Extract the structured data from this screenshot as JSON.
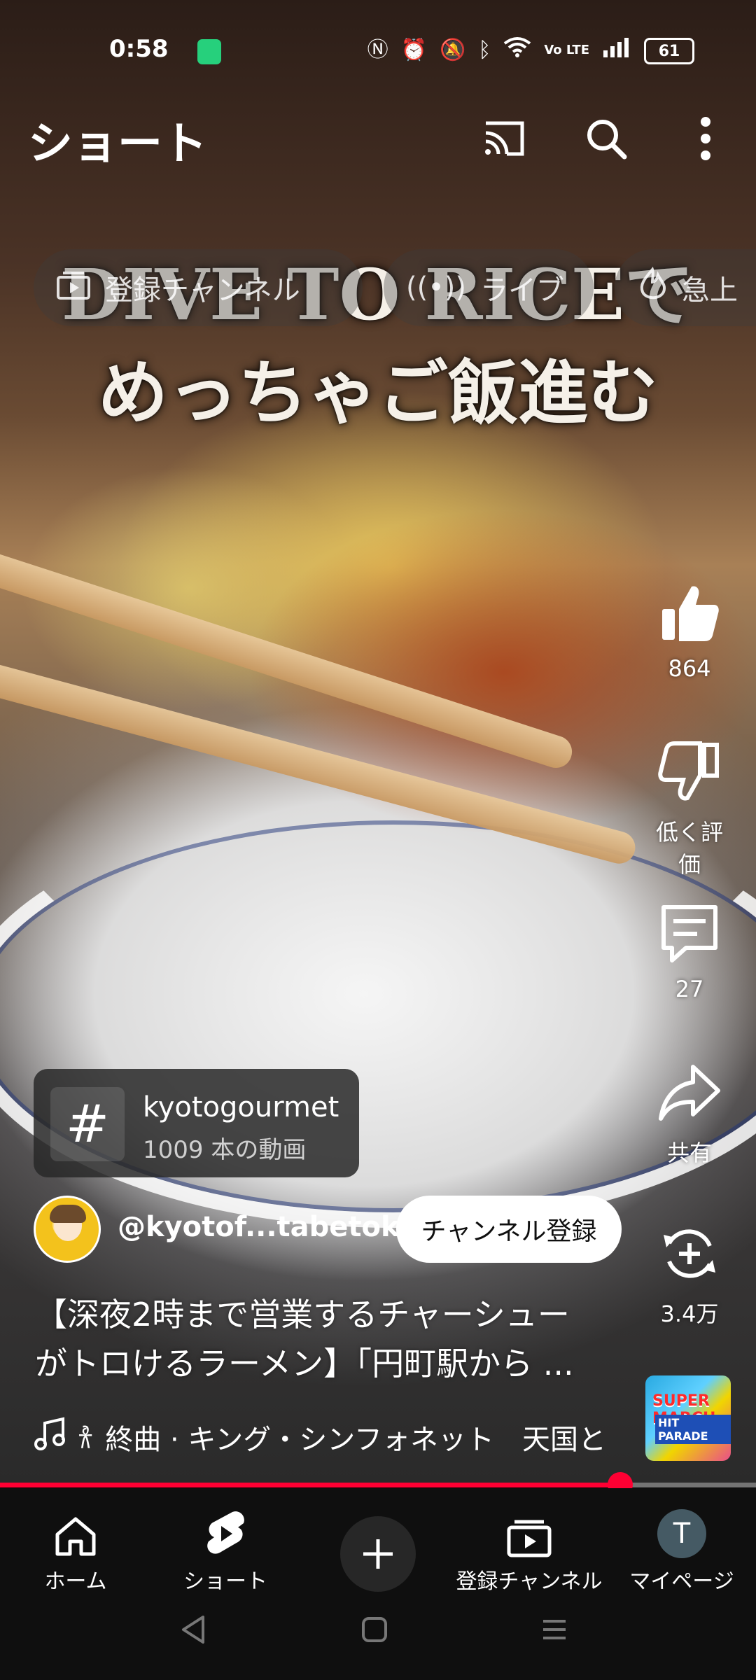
{
  "status_bar": {
    "time": "0:58",
    "battery": "61",
    "icons": [
      "nfc-icon",
      "alarm-icon",
      "mute-icon",
      "bluetooth-icon",
      "wifi-icon",
      "volte-icon",
      "signal-icon"
    ],
    "indicators": {
      "lte": "Vo\nLTE"
    }
  },
  "top_bar": {
    "title": "ショート",
    "icons": [
      "cast-icon",
      "search-icon",
      "more-icon"
    ]
  },
  "chips": [
    {
      "label": "登録チャンネル",
      "icon": "subscriptions-icon"
    },
    {
      "label": "ライブ",
      "icon": "live-icon"
    },
    {
      "label": "急上",
      "icon": "trending-icon"
    }
  ],
  "video_overlay_text": {
    "line1": "DIVE TO RICEで",
    "line2": "めっちゃご飯進む"
  },
  "actions": {
    "like_count": "864",
    "dislike_label": "低く評価",
    "comment_count": "27",
    "share_label": "共有",
    "remix_count": "3.4万"
  },
  "hashtag": {
    "symbol": "#",
    "name": "kyotogourmet",
    "video_count": "1009 本の動画"
  },
  "channel": {
    "handle": "@kyotof...tabetoku",
    "subscribe_label": "チャンネル登録"
  },
  "video_title": {
    "line1": "【深夜2時まで営業するチャーシュー",
    "line2": "がトロけるラーメン】「円町駅から ..."
  },
  "music": {
    "text": "終曲 · キング・シンフォネット　天国と",
    "thumb_line1": "SUPER MARCH",
    "thumb_line2": "HIT PARADE"
  },
  "progress": {
    "fraction": 0.82
  },
  "bottom_nav": {
    "home": "ホーム",
    "shorts": "ショート",
    "subscriptions": "登録チャンネル",
    "my_page": "マイページ",
    "my_avatar_initial": "T"
  },
  "colors": {
    "accent_red": "#ff0033",
    "nav_bg": "#0f0f0f"
  }
}
